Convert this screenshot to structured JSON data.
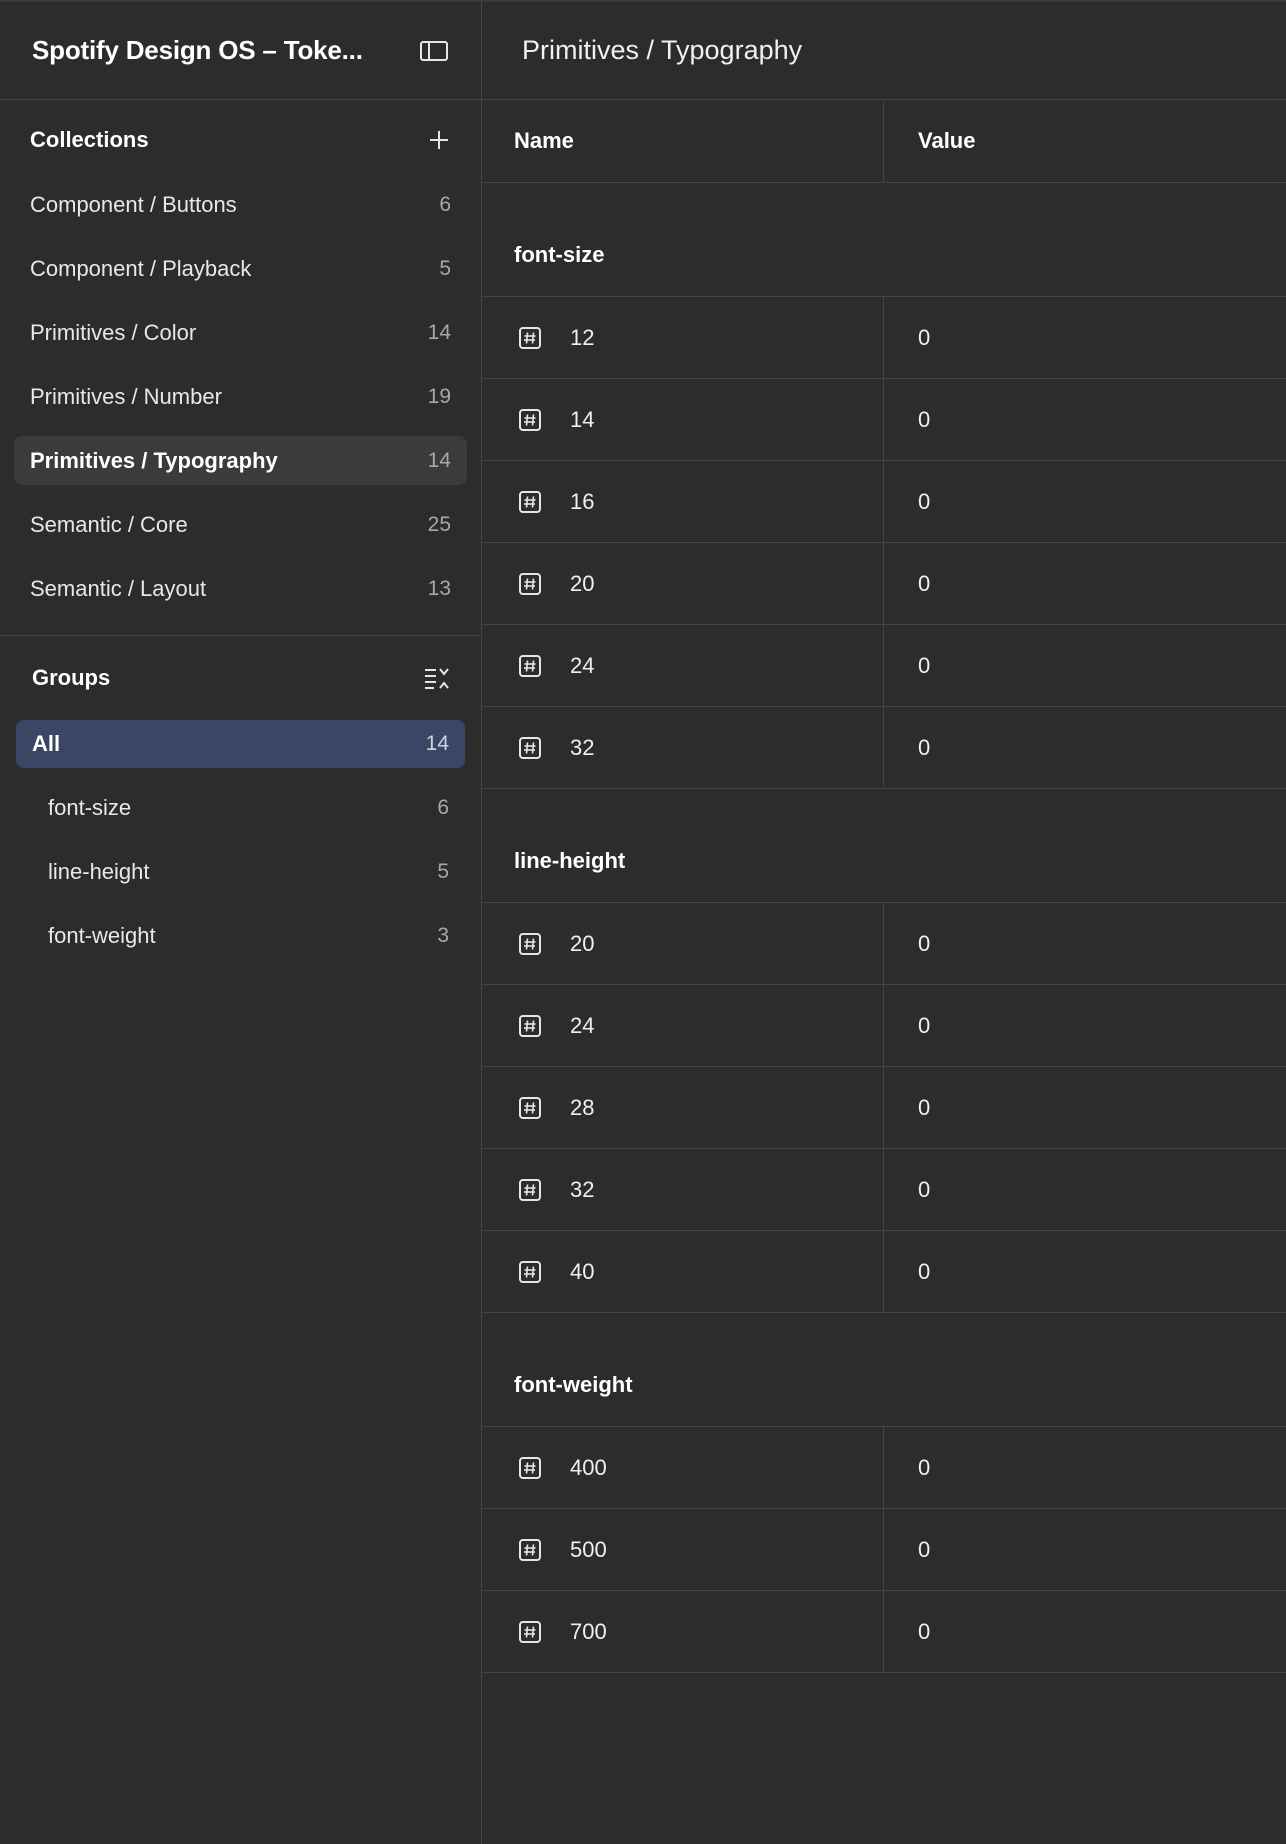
{
  "sidebar": {
    "title": "Spotify Design OS – Toke...",
    "panel_icon": "panel-toggle-icon",
    "collections": {
      "title": "Collections",
      "add_icon": "plus-icon",
      "items": [
        {
          "label": "Component / Buttons",
          "count": "6"
        },
        {
          "label": "Component / Playback",
          "count": "5"
        },
        {
          "label": "Primitives / Color",
          "count": "14"
        },
        {
          "label": "Primitives / Number",
          "count": "19"
        },
        {
          "label": "Primitives / Typography",
          "count": "14",
          "active": true
        },
        {
          "label": "Semantic / Core",
          "count": "25"
        },
        {
          "label": "Semantic / Layout",
          "count": "13"
        }
      ]
    },
    "groups": {
      "title": "Groups",
      "sort_icon": "list-sort-icon",
      "items": [
        {
          "label": "All",
          "count": "14",
          "active": true
        },
        {
          "label": "font-size",
          "count": "6"
        },
        {
          "label": "line-height",
          "count": "5"
        },
        {
          "label": "font-weight",
          "count": "3"
        }
      ]
    }
  },
  "main": {
    "title": "Primitives / Typography",
    "columns": {
      "name": "Name",
      "value": "Value"
    },
    "row_icon": "number-variable-icon",
    "groups": [
      {
        "label": "font-size",
        "rows": [
          {
            "name": "12",
            "value": "0"
          },
          {
            "name": "14",
            "value": "0"
          },
          {
            "name": "16",
            "value": "0"
          },
          {
            "name": "20",
            "value": "0"
          },
          {
            "name": "24",
            "value": "0"
          },
          {
            "name": "32",
            "value": "0"
          }
        ]
      },
      {
        "label": "line-height",
        "rows": [
          {
            "name": "20",
            "value": "0"
          },
          {
            "name": "24",
            "value": "0"
          },
          {
            "name": "28",
            "value": "0"
          },
          {
            "name": "32",
            "value": "0"
          },
          {
            "name": "40",
            "value": "0"
          }
        ]
      },
      {
        "label": "font-weight",
        "rows": [
          {
            "name": "400",
            "value": "0"
          },
          {
            "name": "500",
            "value": "0"
          },
          {
            "name": "700",
            "value": "0"
          }
        ]
      }
    ]
  },
  "colors": {
    "background": "#2c2c2c",
    "border": "#444444",
    "active_collection": "#3b3b3b",
    "active_group": "#3b4566"
  }
}
